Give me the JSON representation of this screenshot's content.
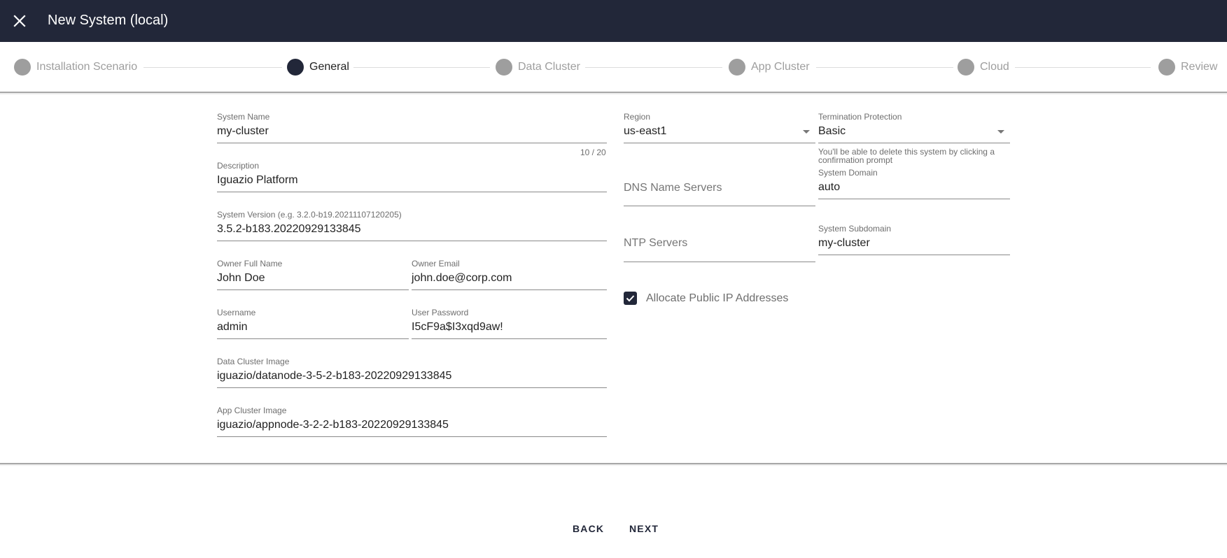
{
  "header": {
    "title": "New System (local)",
    "close_icon": "close-icon",
    "background_color": "#222739"
  },
  "stepper": {
    "steps": [
      {
        "label": "Installation Scenario",
        "state": "inactive"
      },
      {
        "label": "General",
        "state": "active"
      },
      {
        "label": "Data Cluster",
        "state": "inactive"
      },
      {
        "label": "App Cluster",
        "state": "inactive"
      },
      {
        "label": "Cloud",
        "state": "inactive"
      },
      {
        "label": "Review",
        "state": "inactive"
      }
    ]
  },
  "form": {
    "system_name": {
      "label": "System Name",
      "value": "my-cluster",
      "counter": "10 / 20"
    },
    "description": {
      "label": "Description",
      "value": "Iguazio Platform"
    },
    "system_version": {
      "label": "System Version (e.g. 3.2.0-b19.20211107120205)",
      "value": "3.5.2-b183.20220929133845"
    },
    "owner_full_name": {
      "label": "Owner Full Name",
      "value": "John Doe"
    },
    "owner_email": {
      "label": "Owner Email",
      "value": "john.doe@corp.com"
    },
    "username": {
      "label": "Username",
      "value": "admin"
    },
    "user_password": {
      "label": "User Password",
      "value": "I5cF9a$I3xqd9aw!"
    },
    "data_cluster_image": {
      "label": "Data Cluster Image",
      "value": "iguazio/datanode-3-5-2-b183-20220929133845"
    },
    "app_cluster_image": {
      "label": "App Cluster Image",
      "value": "iguazio/appnode-3-2-2-b183-20220929133845"
    },
    "region": {
      "label": "Region",
      "value": "us-east1"
    },
    "termination_protection": {
      "label": "Termination Protection",
      "value": "Basic",
      "hint": "You'll be able to delete this system by clicking a confirmation prompt"
    },
    "dns_name_servers": {
      "placeholder": "DNS Name Servers",
      "value": ""
    },
    "ntp_servers": {
      "placeholder": "NTP Servers",
      "value": ""
    },
    "system_domain": {
      "label": "System Domain",
      "value": "auto"
    },
    "system_subdomain": {
      "label": "System Subdomain",
      "value": "my-cluster"
    },
    "allocate_public_ip": {
      "label": "Allocate Public IP Addresses",
      "checked": true
    }
  },
  "footer": {
    "back_label": "BACK",
    "next_label": "NEXT"
  }
}
